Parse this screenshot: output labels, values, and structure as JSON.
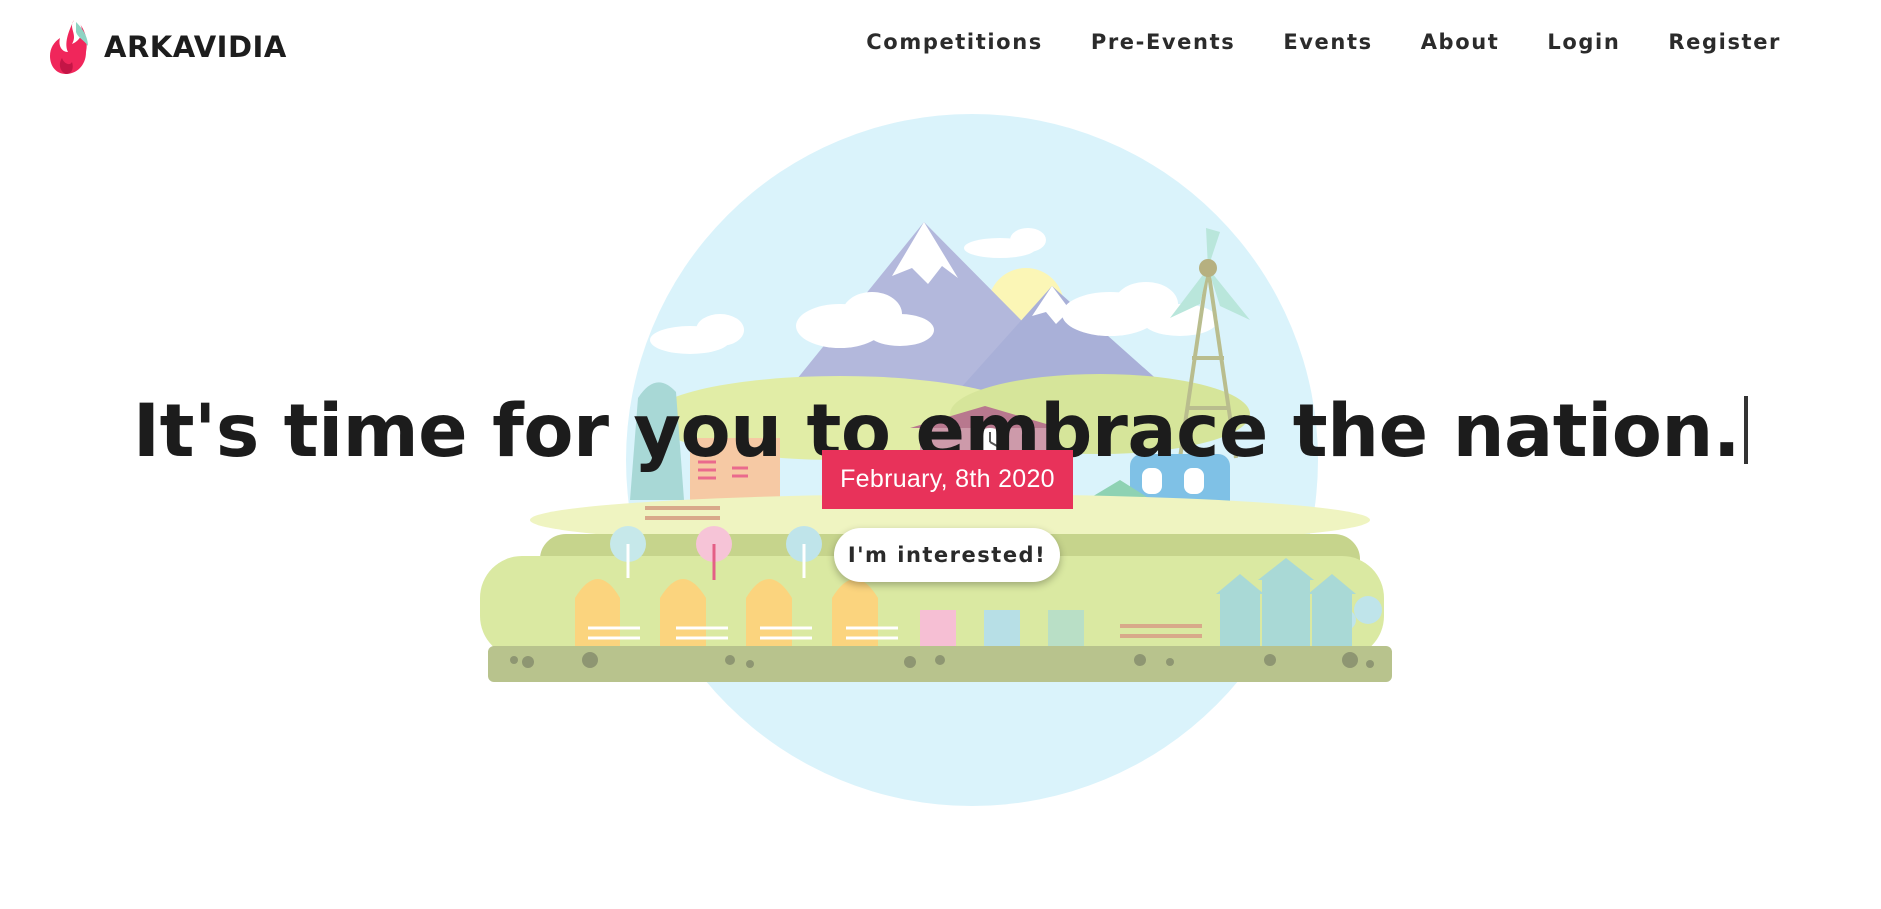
{
  "brand": {
    "name": "ARKAVIDIA",
    "logo_icon": "flame-logo-icon",
    "accent": "#f0265b"
  },
  "nav": {
    "items": [
      {
        "label": "Competitions"
      },
      {
        "label": "Pre-Events"
      },
      {
        "label": "Events"
      },
      {
        "label": "About"
      },
      {
        "label": "Login"
      },
      {
        "label": "Register"
      }
    ]
  },
  "hero": {
    "headline": "It's time for you to embrace the nation.",
    "date": "February, 8th 2020",
    "cta_label": "I'm interested!",
    "badge_color": "#e8325a"
  }
}
